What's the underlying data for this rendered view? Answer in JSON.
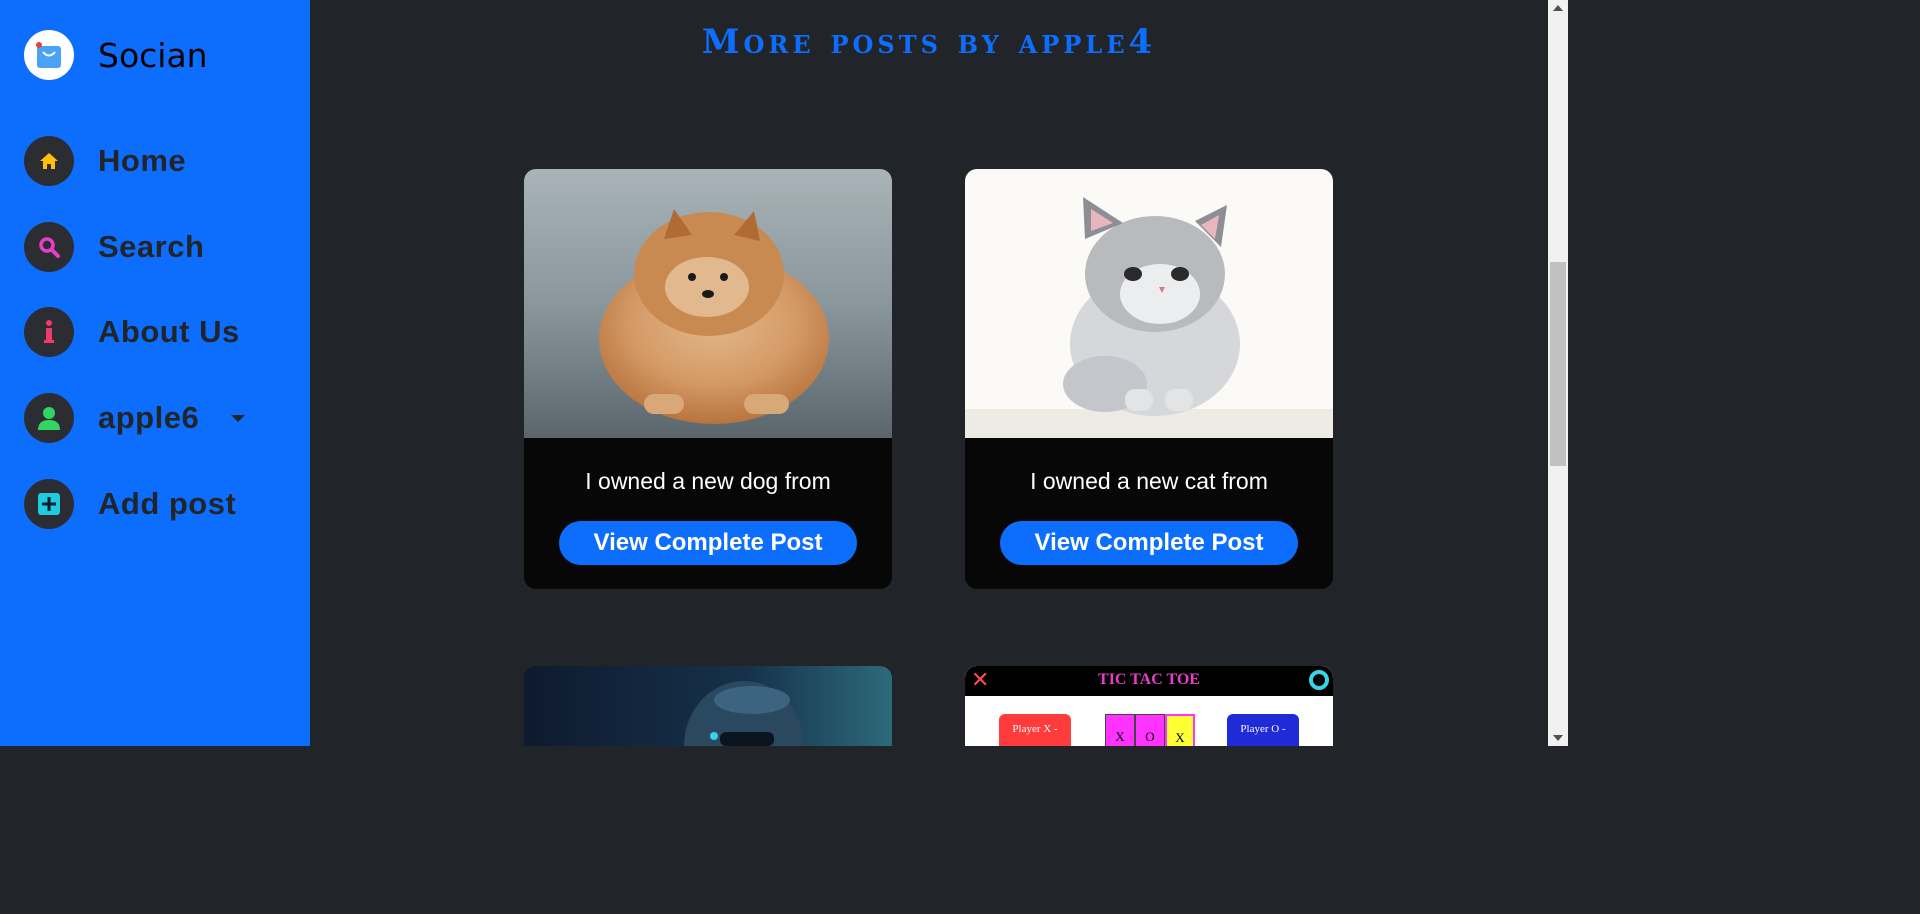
{
  "brand": {
    "name": "Socian"
  },
  "nav": [
    {
      "label": "Home",
      "icon": "home-icon",
      "icon_color": "#ffc107"
    },
    {
      "label": "Search",
      "icon": "search-icon",
      "icon_color": "#e83ec8"
    },
    {
      "label": "About Us",
      "icon": "info-icon",
      "icon_color": "#f0396d"
    },
    {
      "label": "apple6",
      "icon": "user-icon",
      "icon_color": "#34d462"
    },
    {
      "label": "Add post",
      "icon": "add-icon",
      "icon_color": "#1ecbe1"
    }
  ],
  "main": {
    "heading": "More posts by apple4",
    "posts": [
      {
        "text": "I owned a new dog from",
        "button": "View Complete Post",
        "image": "pomeranian-dog-photo"
      },
      {
        "text": "I owned a new cat from",
        "button": "View Complete Post",
        "image": "kitten-painting"
      },
      {
        "image": "astronaut-helmet-art"
      },
      {
        "image": "tic-tac-toe-screenshot",
        "game": {
          "title": "TIC TAC TOE",
          "x_score": "Player X - Score",
          "o_score": "Player O - Score",
          "cells": [
            "X",
            "O",
            "X"
          ]
        }
      }
    ]
  },
  "colors": {
    "accent": "#0d6efd",
    "background": "#212429",
    "card": "#070708"
  }
}
